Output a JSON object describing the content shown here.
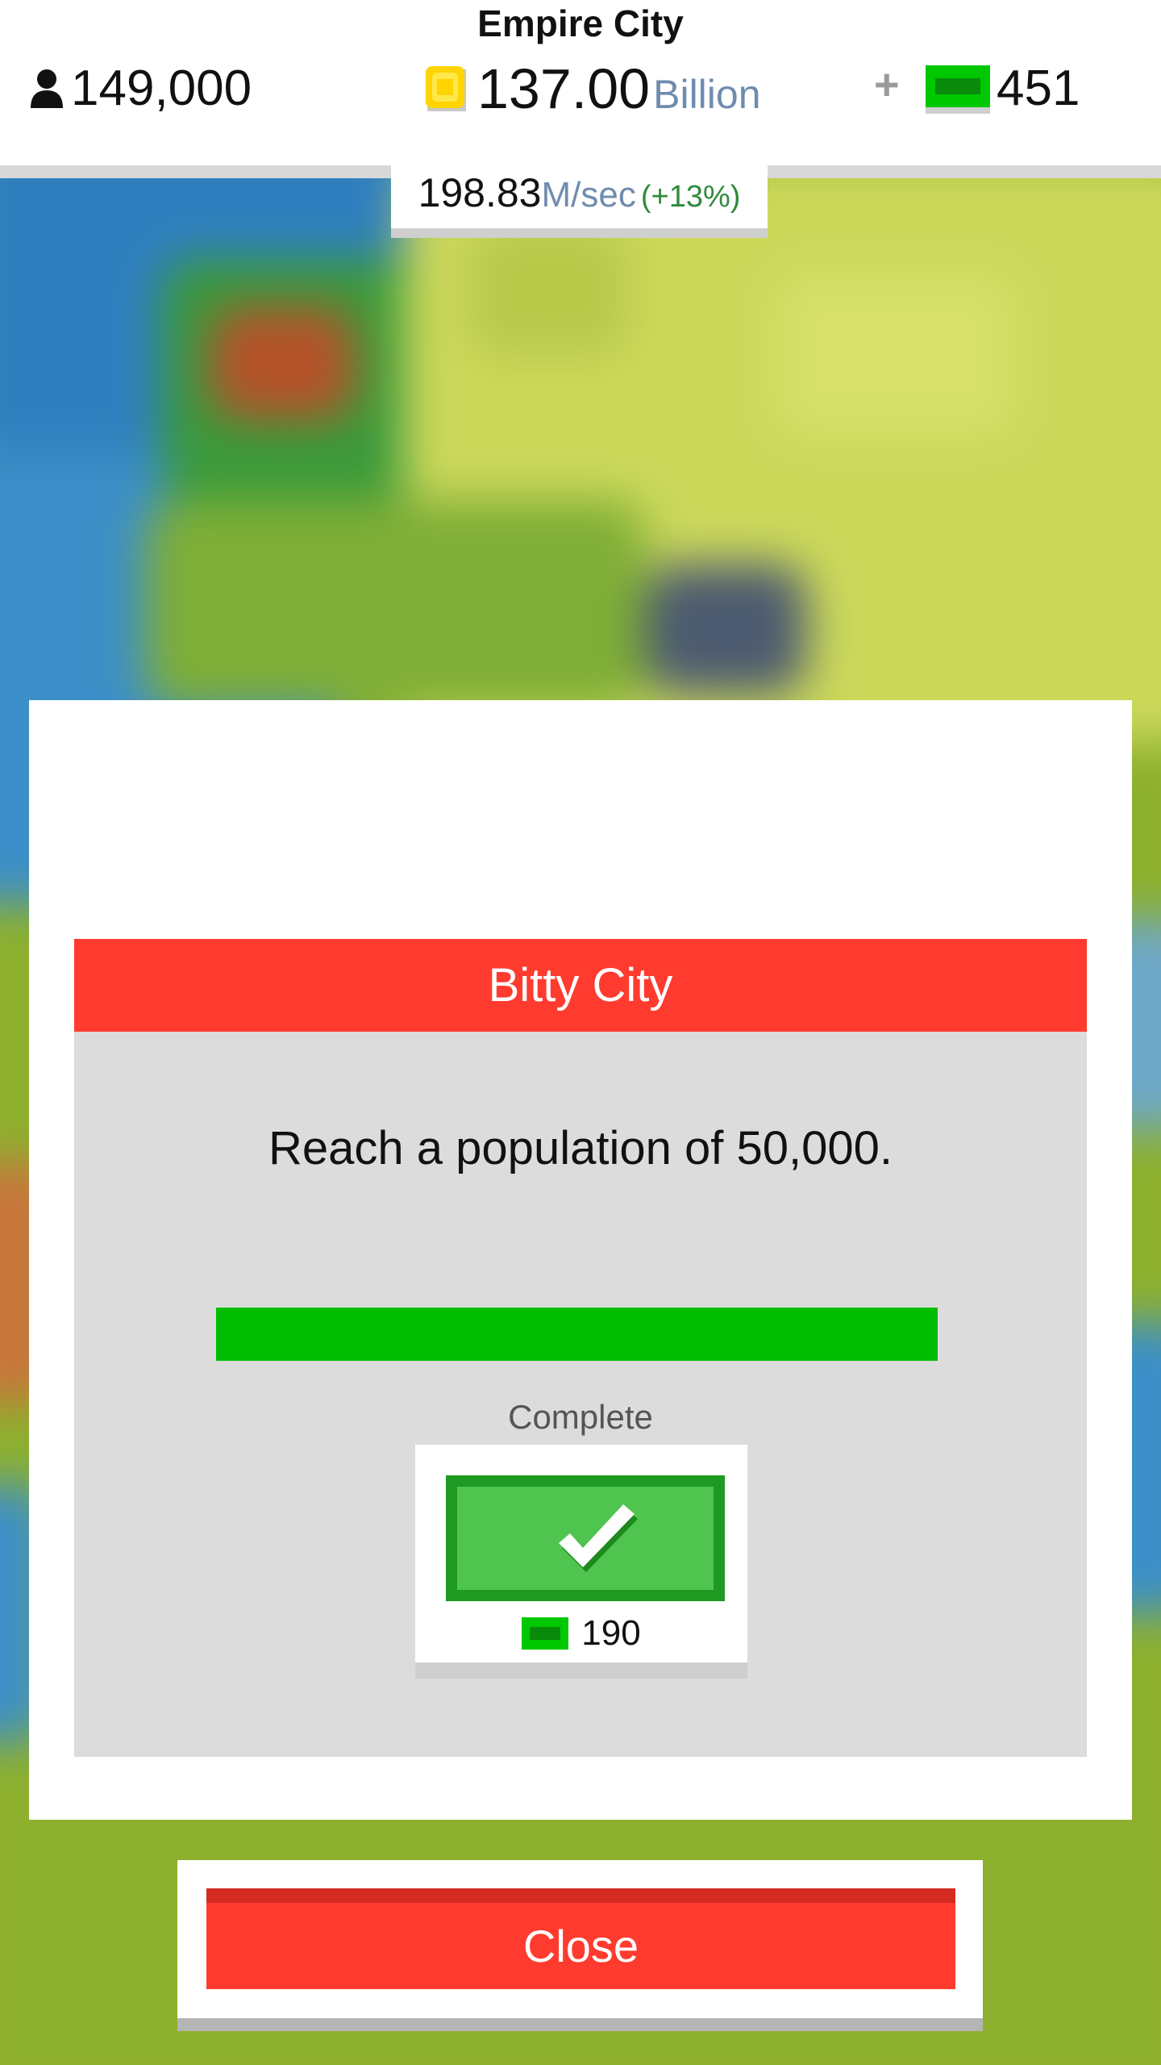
{
  "header": {
    "city_name": "Empire City",
    "population": "149,000",
    "coins_amount": "137.00",
    "coins_unit": "Billion",
    "plus_label": "+",
    "bux_amount": "451",
    "rate_value": "198.83",
    "rate_unit": "M/sec",
    "rate_bonus": "(+13%)"
  },
  "mission": {
    "title": "Bitty City",
    "description": "Reach a population of 50,000.",
    "progress_fraction": 1.0,
    "status": "Complete",
    "reward_amount": "190",
    "reward_icon": "bux-icon",
    "claim_icon": "checkmark-icon"
  },
  "footer": {
    "close_label": "Close"
  },
  "colors": {
    "header_red": "#ff3b2f",
    "progress_green": "#00bd00",
    "claim_green": "#4fc44f",
    "claim_border": "#1e9a22",
    "coin_gold": "#ffd400",
    "bux_green": "#00c800",
    "unit_blue": "#6f8cae"
  }
}
